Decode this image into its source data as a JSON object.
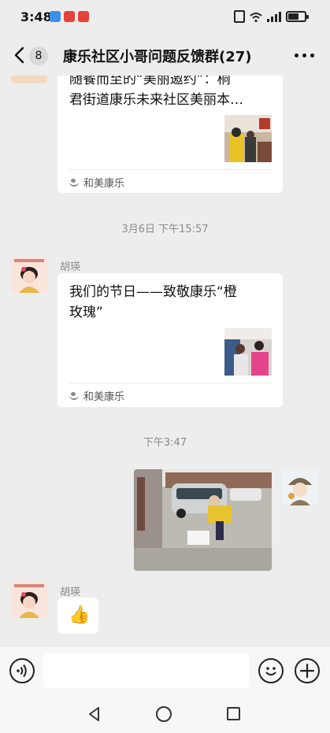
{
  "status_bar": {
    "time": "3:48"
  },
  "header": {
    "back_icon": "chevron-left-icon",
    "unread_count": "8",
    "title": "康乐社区小哥问题反馈群(27)",
    "more_icon": "more-horizontal-icon"
  },
  "messages": [
    {
      "type": "link_card",
      "title_lines": [
        "随餐而至的“美丽邀约”：桐",
        "君街道康乐未来社区美丽本…"
      ],
      "source": "和美康乐"
    },
    {
      "type": "timestamp",
      "text": "3月6日 下午15:57"
    },
    {
      "type": "link_card",
      "sender": "胡瑛",
      "title_lines": [
        "我们的节日——致敬康乐“橙",
        "玫瑰”"
      ],
      "source": "和美康乐"
    },
    {
      "type": "timestamp",
      "text": "下午3:47"
    },
    {
      "type": "image",
      "sender": "self"
    },
    {
      "type": "emoji",
      "sender": "胡瑛",
      "emoji": "👍"
    }
  ],
  "input_bar": {
    "placeholder": "",
    "value": ""
  },
  "colors": {
    "background": "#ededed",
    "bubble": "#ffffff",
    "meta_text": "#8a8a8a"
  }
}
